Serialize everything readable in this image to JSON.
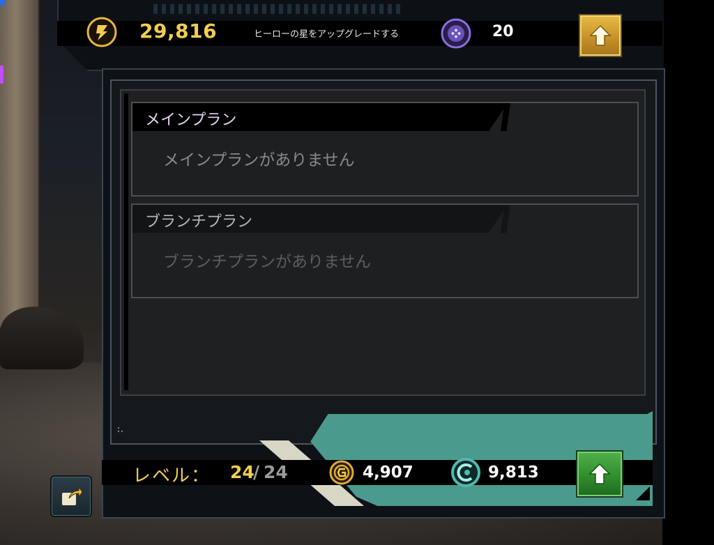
{
  "header": {
    "star_currency_value": "29,816",
    "upgrade_stars_label": "ヒーローの星をアップグレードする",
    "token_value": "20",
    "upgrade_button_icon": "up-arrow-icon"
  },
  "main_plan": {
    "title": "メインプラン",
    "empty_text": "メインプランがありません"
  },
  "branch_plan": {
    "title": "ブランチプラン",
    "empty_text": "ブランチプランがありません"
  },
  "footer": {
    "level_label": "レベル：",
    "level_current": "24",
    "level_separator": "/",
    "level_max": "24",
    "gold_value": "4,907",
    "teal_value": "9,813",
    "level_up_icon": "up-arrow-icon",
    "share_icon": "share-icon"
  },
  "colors": {
    "accent_gold": "#f2cd52",
    "accent_teal": "#4b9a8e",
    "button_green": "#3a9b36",
    "button_gold": "#d9a437",
    "plan_title_tint": "#e8d3f0"
  }
}
